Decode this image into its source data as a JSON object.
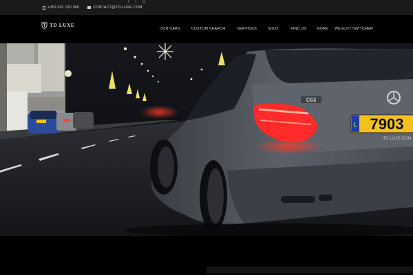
{
  "topbar": {
    "phone": "+352 691 130 960",
    "email": "CONTACT@TD-LUXE.COM",
    "social": [
      {
        "icon": "facebook-icon",
        "glyph": "f"
      },
      {
        "icon": "twitter-icon",
        "glyph": "t"
      },
      {
        "icon": "instagram-icon",
        "glyph": "◘"
      }
    ]
  },
  "brand": {
    "logo_text": "TD LUXE"
  },
  "nav": {
    "items": [
      "OUR CARS",
      "CUSTOM SEARCH",
      "SERVICES",
      "SOLD",
      "FIND US",
      "MORE",
      "WEGLOT SWITCHER"
    ]
  },
  "hero": {
    "plate_text": "7903",
    "plate_prefix": "L",
    "plate_sub": "TD-LUXE.COM",
    "badge_text": "C63"
  },
  "colors": {
    "topbar_bg": "#1a1a1a",
    "nav_bg": "#000000",
    "plate_yellow": "#f2c21b",
    "taillight_red": "#ff2a2a"
  }
}
